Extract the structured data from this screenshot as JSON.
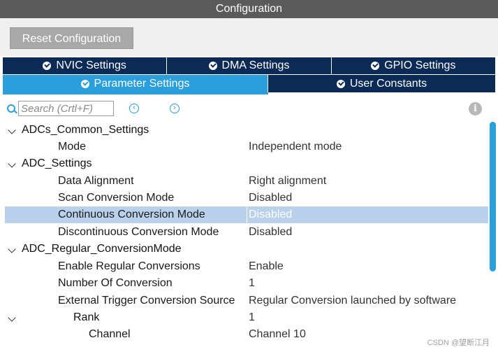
{
  "header": {
    "title": "Configuration"
  },
  "toolbar": {
    "reset_label": "Reset Configuration"
  },
  "tabs": {
    "row1": [
      {
        "label": "NVIC Settings",
        "active": false
      },
      {
        "label": "DMA Settings",
        "active": false
      },
      {
        "label": "GPIO Settings",
        "active": false
      }
    ],
    "row2": [
      {
        "label": "Parameter Settings",
        "active": true
      },
      {
        "label": "User Constants",
        "active": false
      }
    ]
  },
  "search": {
    "placeholder": "Search (Crtl+F)",
    "value": ""
  },
  "icons": {
    "search": "search-icon",
    "prev": "arrow-left-circle-icon",
    "next": "arrow-right-circle-icon",
    "info": "info-icon"
  },
  "tree": [
    {
      "name": "ADCs_Common_Settings",
      "value": "",
      "level": 0,
      "group": true
    },
    {
      "name": "Mode",
      "value": "Independent mode",
      "level": 1
    },
    {
      "name": "ADC_Settings",
      "value": "",
      "level": 0,
      "group": true
    },
    {
      "name": "Data Alignment",
      "value": "Right alignment",
      "level": 1
    },
    {
      "name": "Scan Conversion Mode",
      "value": "Disabled",
      "level": 1
    },
    {
      "name": "Continuous Conversion Mode",
      "value": "Disabled",
      "level": 1,
      "selected": true
    },
    {
      "name": "Discontinuous Conversion Mode",
      "value": "Disabled",
      "level": 1
    },
    {
      "name": "ADC_Regular_ConversionMode",
      "value": "",
      "level": 0,
      "group": true
    },
    {
      "name": "Enable Regular Conversions",
      "value": "Enable",
      "level": 1
    },
    {
      "name": "Number Of Conversion",
      "value": "1",
      "level": 1
    },
    {
      "name": "External Trigger Conversion Source",
      "value": "Regular Conversion launched by software",
      "level": 1
    },
    {
      "name": "Rank",
      "value": "1",
      "level": 2,
      "group": true
    },
    {
      "name": "Channel",
      "value": "Channel 10",
      "level": 3
    }
  ],
  "watermark": "CSDN @望断江月",
  "colors": {
    "title_bg": "#5a5a5a",
    "tab_dark": "#0c2a56",
    "tab_active": "#2a9fdc",
    "selection": "#b9d1ea"
  }
}
